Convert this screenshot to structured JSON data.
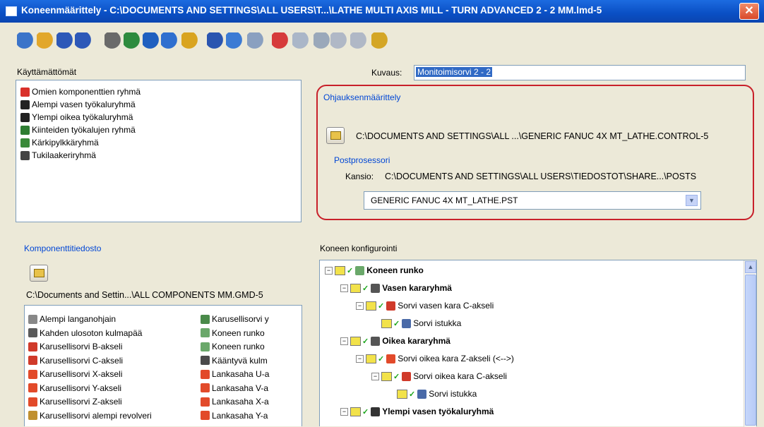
{
  "window": {
    "title": "Koneenmäärittely  - C:\\DOCUMENTS AND SETTINGS\\ALL USERS\\T...\\LATHE MULTI AXIS MILL - TURN ADVANCED 2 - 2 MM.lmd-5",
    "close_glyph": "✕"
  },
  "toolbar": {
    "icons": [
      "new-file-icon",
      "open-folder-icon",
      "save-icon",
      "save-as-icon",
      "control-icon",
      "machine-icon",
      "component-icon",
      "arrow-icon",
      "warning-icon",
      "disk-icon",
      "monitor-icon",
      "wand-icon",
      "axis-icon",
      "grid-icon",
      "hierarchy-icon",
      "move-icon",
      "connect-icon",
      "lock-icon"
    ]
  },
  "unused": {
    "label": "Käyttämättömät",
    "items": [
      {
        "label": "Omien komponenttien ryhmä",
        "icon": "question-icon",
        "color": "#d9302a"
      },
      {
        "label": "Alempi vasen työkaluryhmä",
        "icon": "turret-icon",
        "color": "#222222"
      },
      {
        "label": "Ylempi oikea työkaluryhmä",
        "icon": "turret-icon",
        "color": "#222222"
      },
      {
        "label": "Kiinteiden työkalujen ryhmä",
        "icon": "tool-block-icon",
        "color": "#2e7d32"
      },
      {
        "label": "Kärkipylkkäryhmä",
        "icon": "tailstock-icon",
        "color": "#3a8a3a"
      },
      {
        "label": "Tukilaakeriryhmä",
        "icon": "bearing-icon",
        "color": "#444444"
      }
    ]
  },
  "description": {
    "label": "Kuvaus:",
    "value": "Monitoimisorvi 2 - 2"
  },
  "control": {
    "group_label": "Ohjauksenmäärittely",
    "path": "C:\\DOCUMENTS AND SETTINGS\\ALL ...\\GENERIC FANUC 4X MT_LATHE.CONTROL-5",
    "post": {
      "group_label": "Postprosessori",
      "folder_label": "Kansio:",
      "folder_path": "C:\\DOCUMENTS AND SETTINGS\\ALL USERS\\TIEDOSTOT\\SHARE...\\POSTS",
      "selected": "GENERIC FANUC 4X MT_LATHE.PST"
    },
    "highlight_color": "#c8202a"
  },
  "component_file": {
    "group_label": "Komponenttitiedosto",
    "path": "C:\\Documents and Settin...\\ALL COMPONENTS MM.GMD-5",
    "col1": [
      "Alempi langanohjain",
      "Kahden ulosoton kulmapää",
      "Karusellisorvi B-akseli",
      "Karusellisorvi C-akseli",
      "Karusellisorvi X-akseli",
      "Karusellisorvi Y-akseli",
      "Karusellisorvi Z-akseli",
      "Karusellisorvi alempi revolveri"
    ],
    "col2": [
      "Karusellisorvi y",
      "Koneen runko",
      "Koneen runko",
      "Kääntyvä kulm",
      "Lankasaha U-a",
      "Lankasaha V-a",
      "Lankasaha X-a",
      "Lankasaha Y-a"
    ]
  },
  "config": {
    "group_label": "Koneen konfigurointi",
    "tree": [
      {
        "label": "Koneen runko",
        "bold": true
      },
      {
        "label": "Vasen kararyhmä",
        "bold": true
      },
      {
        "label": "Sorvi vasen kara C-akseli",
        "bold": false
      },
      {
        "label": "Sorvi istukka",
        "bold": false
      },
      {
        "label": "Oikea kararyhmä",
        "bold": true
      },
      {
        "label": "Sorvi oikea kara Z-akseli (<-->)",
        "bold": false
      },
      {
        "label": "Sorvi oikea kara C-akseli",
        "bold": false
      },
      {
        "label": "Sorvi istukka",
        "bold": false
      },
      {
        "label": "Ylempi vasen työkaluryhmä",
        "bold": true
      }
    ],
    "expander": "−"
  }
}
